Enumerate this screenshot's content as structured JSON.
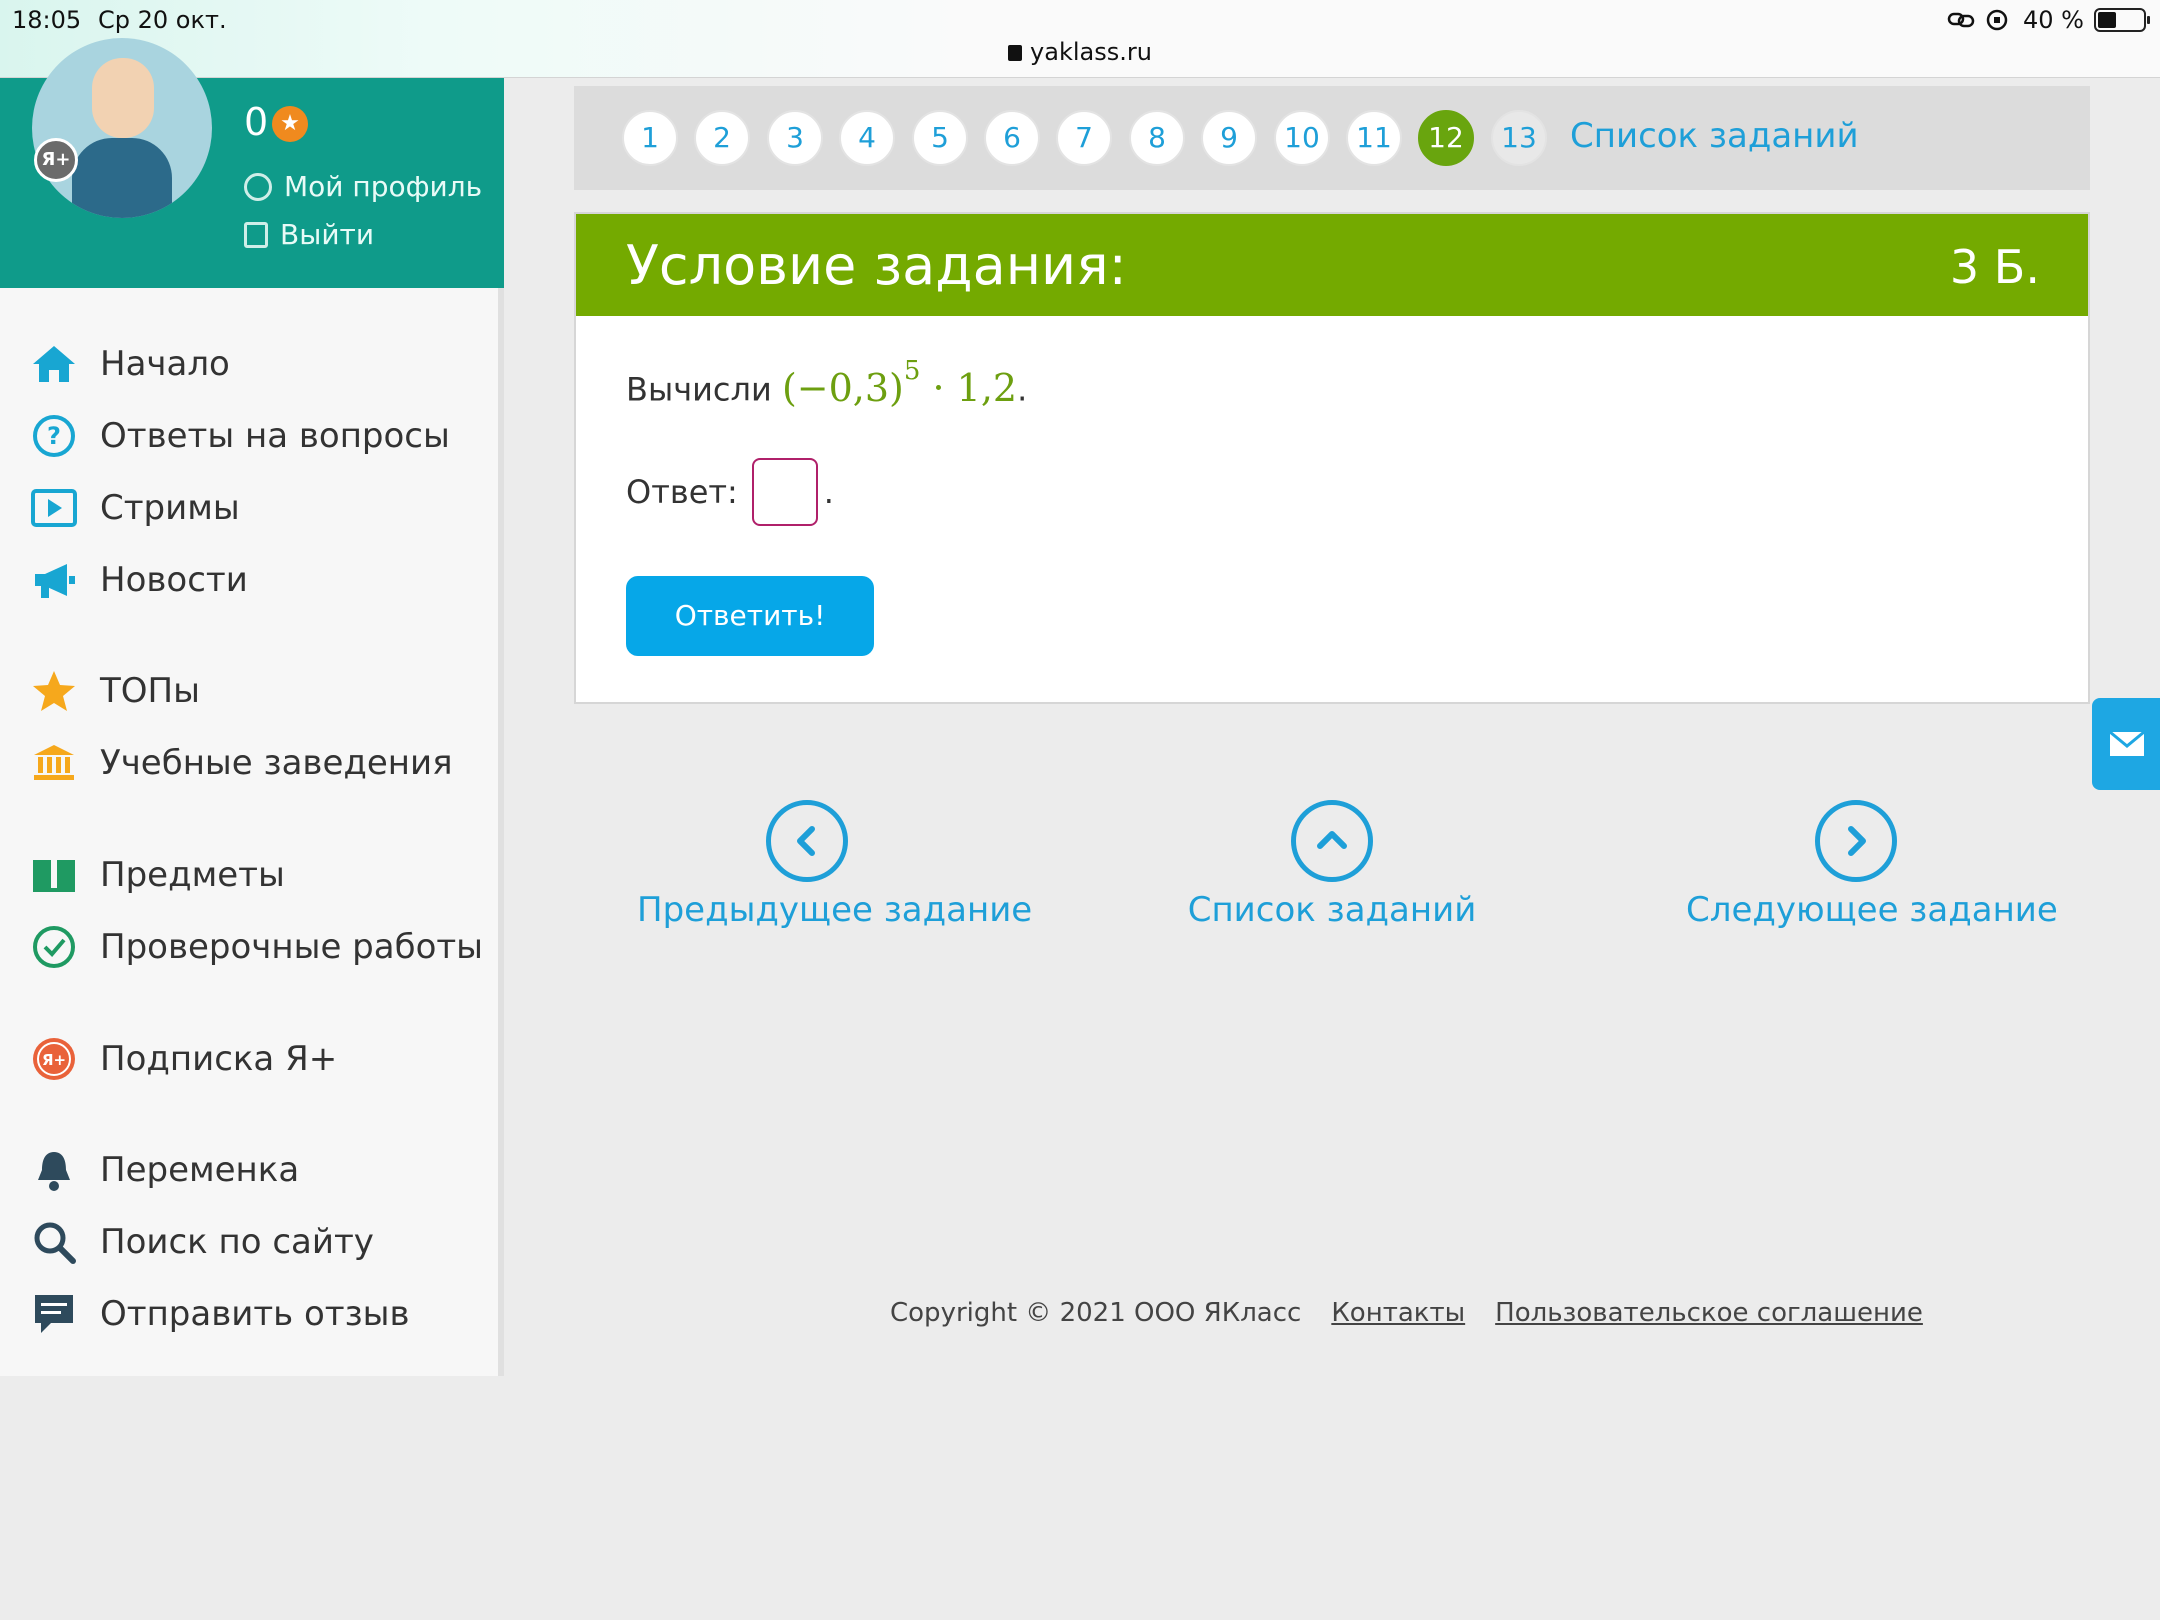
{
  "statusbar": {
    "time": "18:05",
    "date": "Ср 20 окт.",
    "battery_text": "40 %",
    "battery_level": 0.4
  },
  "browser": {
    "url": "yaklass.ru"
  },
  "profile": {
    "points": "0",
    "badge_text": "Я+",
    "my_profile": "Мой профиль",
    "logout": "Выйти"
  },
  "sidebar": {
    "items": [
      {
        "label": "Начало",
        "icon": "home-icon"
      },
      {
        "label": "Ответы на вопросы",
        "icon": "question-icon"
      },
      {
        "label": "Стримы",
        "icon": "stream-icon"
      },
      {
        "label": "Новости",
        "icon": "megaphone-icon"
      },
      {
        "label": "ТОПы",
        "icon": "star-icon"
      },
      {
        "label": "Учебные заведения",
        "icon": "school-icon"
      },
      {
        "label": "Предметы",
        "icon": "book-icon"
      },
      {
        "label": "Проверочные работы",
        "icon": "check-icon"
      },
      {
        "label": "Подписка Я+",
        "icon": "subscription-icon"
      },
      {
        "label": "Переменка",
        "icon": "bell-icon"
      },
      {
        "label": "Поиск по сайту",
        "icon": "search-icon"
      },
      {
        "label": "Отправить отзыв",
        "icon": "feedback-icon"
      }
    ]
  },
  "task_nav": {
    "numbers": [
      "1",
      "2",
      "3",
      "4",
      "5",
      "6",
      "7",
      "8",
      "9",
      "10",
      "11",
      "12",
      "13"
    ],
    "active": "12",
    "list_link": "Список заданий"
  },
  "task": {
    "header_title": "Условие задания:",
    "header_points": "3 Б.",
    "question_prefix": "Вычисли",
    "expr_base": "(−0,3)",
    "expr_exp": "5",
    "expr_rest": " · 1,2",
    "answer_label": "Ответ:",
    "answer_value": "",
    "submit_label": "Ответить!"
  },
  "bottom_nav": {
    "prev": "Предыдущее задание",
    "list": "Список заданий",
    "next": "Следующее задание"
  },
  "footer": {
    "copyright": "Copyright © 2021 ООО ЯКласс",
    "contacts": "Контакты",
    "agreement": "Пользовательское соглашение"
  },
  "colors": {
    "teal": "#0f9b8a",
    "green": "#74aa00",
    "blue": "#1e9fd8",
    "button": "#06a7e8"
  }
}
